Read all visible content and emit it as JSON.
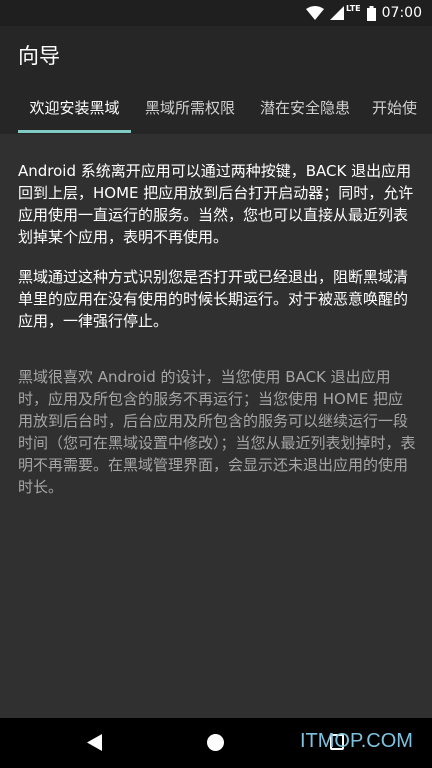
{
  "status_bar": {
    "network": "LTE",
    "time": "07:00"
  },
  "app_bar": {
    "title": "向导"
  },
  "tabs": [
    {
      "label": "欢迎安装黑域",
      "active": true
    },
    {
      "label": "黑域所需权限",
      "active": false
    },
    {
      "label": "潜在安全隐患",
      "active": false
    },
    {
      "label": "开始使",
      "active": false
    }
  ],
  "content": {
    "paragraphs": [
      "Android 系统离开应用可以通过两种按键，BACK 退出应用回到上层，HOME 把应用放到后台打开启动器；同时，允许应用使用一直运行的服务。当然，您也可以直接从最近列表划掉某个应用，表明不再使用。",
      "黑域通过这种方式识别您是否打开或已经退出，阻断黑域清单里的应用在没有使用的时候长期运行。对于被恶意唤醒的应用，一律强行停止。",
      "黑域很喜欢 Android 的设计，当您使用 BACK 退出应用时，应用及所包含的服务不再运行；当您使用 HOME 把应用放到后台时，后台应用及所包含的服务可以继续运行一段时间（您可在黑域设置中修改）；当您从最近列表划掉时，表明不再需要。在黑域管理界面，会显示还未退出应用的使用时长。"
    ]
  },
  "watermark": "ITMOP.COM",
  "colors": {
    "background": "#303030",
    "app_bar": "#262626",
    "tab_indicator": "#80cbc4",
    "secondary_text": "#a6a6a6",
    "watermark": "#7ec2e0"
  }
}
